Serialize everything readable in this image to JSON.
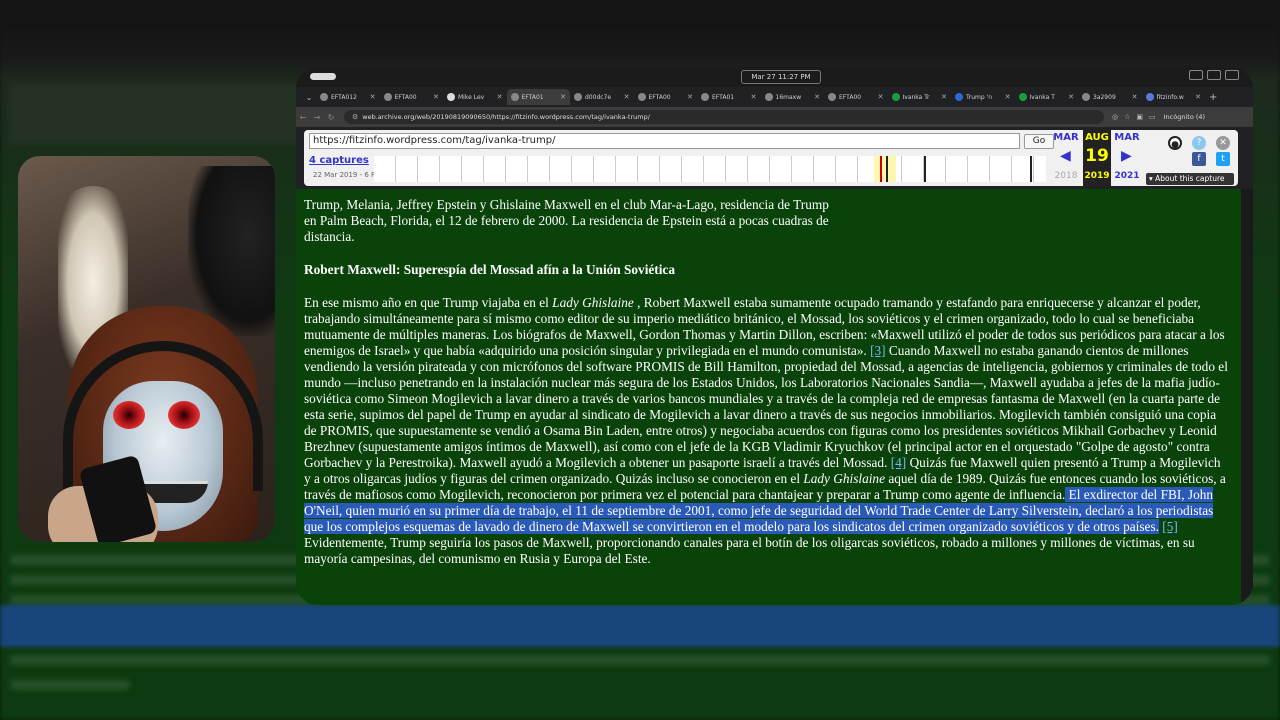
{
  "os": {
    "clock": "Mar 27  11:27 PM"
  },
  "tabs": [
    {
      "title": "EFTA012",
      "color": "#888"
    },
    {
      "title": "EFTA00",
      "color": "#888"
    },
    {
      "title": "Mike Lev",
      "color": "#ddd"
    },
    {
      "title": "EFTA01",
      "color": "#888",
      "active": true
    },
    {
      "title": "d00dc7e",
      "color": "#888"
    },
    {
      "title": "EFTA00",
      "color": "#888"
    },
    {
      "title": "EFTA01",
      "color": "#888"
    },
    {
      "title": "16maxw",
      "color": "#888"
    },
    {
      "title": "EFTA00",
      "color": "#888"
    },
    {
      "title": "Ivanka Tr",
      "color": "#1a9e3a"
    },
    {
      "title": "Trump 'n",
      "color": "#2a6ad8"
    },
    {
      "title": "Ivanka T",
      "color": "#1a9e3a"
    },
    {
      "title": "3a2909",
      "color": "#888"
    },
    {
      "title": "fitzinfo.w",
      "color": "#5a7ad8"
    }
  ],
  "urlbar": {
    "url": "web.archive.org/web/20190819090650/https://fitzinfo.wordpress.com/tag/ivanka-trump/",
    "profile": "Incógnito (4)"
  },
  "wayback": {
    "url_value": "https://fitzinfo.wordpress.com/tag/ivanka-trump/",
    "go_label": "Go",
    "captures": "4 captures",
    "date_range": "22 Mar 2019 - 6 Fe",
    "prev_month": "MAR",
    "cur_month": "AUG",
    "next_month": "MAR",
    "day": "19",
    "prev_year": "2018",
    "cur_year": "2019",
    "next_year": "2021",
    "about": "▾ About this capture"
  },
  "article": {
    "caption": "Trump, Melania, Jeffrey Epstein y Ghislaine Maxwell en el club Mar-a-Lago, residencia de Trump en Palm Beach, Florida, el 12 de febrero de 2000. La residencia de Epstein está a pocas cuadras de distancia.",
    "heading": "Robert Maxwell: Superespía del Mossad afín a la Unión Soviética",
    "p1_a": "En ese mismo año en que Trump viajaba en el ",
    "p1_italic1": "Lady Ghislaine",
    "p1_b": " , Robert Maxwell estaba sumamente ocupado tramando y estafando para enriquecerse y alcanzar el poder, trabajando simultáneamente para sí mismo como editor de su imperio mediático británico, el Mossad, los soviéticos y el crimen organizado, todo lo cual se beneficiaba mutuamente de múltiples maneras. Los biógrafos de Maxwell, Gordon Thomas y Martin Dillon, escriben: «Maxwell utilizó el poder de todos sus periódicos para atacar a los enemigos de Israel» y que había «adquirido una posición singular y privilegiada en el mundo comunista».",
    "fn3": "[3]",
    "p1_c": " Cuando Maxwell no estaba ganando cientos de millones vendiendo la versión pirateada y con micrófonos del software PROMIS de Bill Hamilton, propiedad del Mossad, a agencias de inteligencia, gobiernos y criminales de todo el mundo —incluso penetrando en la instalación nuclear más segura de los Estados Unidos, los Laboratorios Nacionales Sandia—, Maxwell ayudaba a jefes de la mafia judío-soviética como Simeon Mogilevich a lavar dinero a través de varios bancos mundiales y a través de la compleja red de empresas fantasma de Maxwell (en la cuarta parte de esta serie, supimos del papel de Trump en ayudar al sindicato de Mogilevich a lavar dinero a través de sus negocios inmobiliarios. Mogilevich también consiguió una copia de PROMIS, que supuestamente se vendió a Osama Bin Laden, entre otros) y negociaba acuerdos con figuras como los presidentes soviéticos Mikhail Gorbachev y Leonid Brezhnev (supuestamente amigos íntimos de Maxwell), así como con el jefe de la KGB Vladimir Kryuchkov (el principal actor en el orquestado \"Golpe de agosto\" contra Gorbachev y la Perestroika). Maxwell ayudó a Mogilevich a obtener un pasaporte israelí a través del Mossad.",
    "fn4": "[4]",
    "p1_d": " Quizás fue Maxwell quien presentó a Trump a Mogilevich y a otros oligarcas judíos y figuras del crimen organizado. Quizás incluso se conocieron en el ",
    "p1_italic2": "Lady Ghislaine",
    "p1_e": " aquel día de 1989. Quizás fue entonces cuando los soviéticos, a través de mafiosos como Mogilevich, reconocieron por primera vez el potencial para chantajear y preparar a Trump como agente de influencia.",
    "p1_sel": " El exdirector del FBI, John O'Neil, quien murió en su primer día de trabajo, el 11 de septiembre de 2001, como jefe de seguridad del World Trade Center de Larry Silverstein, declaró a los periodistas que los complejos esquemas de lavado de dinero de Maxwell se convirtieron en el modelo para los sindicatos del crimen organizado soviéticos y de otros países.",
    "fn5": "[5]",
    "p1_f": " Evidentemente, Trump seguiría los pasos de Maxwell, proporcionando canales para el botín de los oligarcas soviéticos, robado a millones y millones de víctimas, en su mayoría campesinas, del comunismo en Rusia y Europa del Este."
  }
}
